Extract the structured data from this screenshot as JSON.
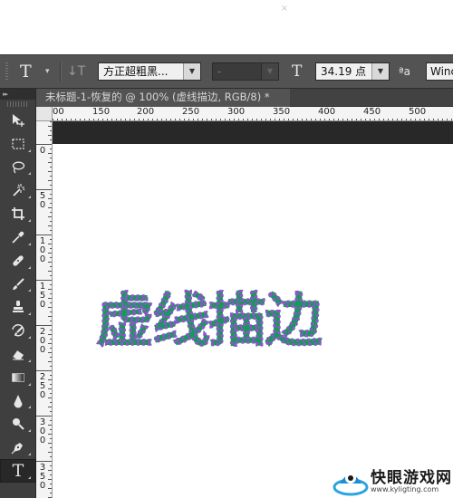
{
  "options_bar": {
    "tool_glyph": "T",
    "orientation_glyph": "↓T",
    "font_family": "方正超粗黑...",
    "font_style": "-",
    "size_glyph": "T",
    "font_size": "34.19 点",
    "antialias_glyph": "ªa",
    "antialias_value": "Winc"
  },
  "toolbar": {
    "collapse_glyph": "▸▸",
    "tools": [
      {
        "name": "move",
        "active": false
      },
      {
        "name": "marquee",
        "active": false
      },
      {
        "name": "lasso",
        "active": false
      },
      {
        "name": "magic-wand",
        "active": false
      },
      {
        "name": "crop",
        "active": false
      },
      {
        "name": "eyedropper",
        "active": false
      },
      {
        "name": "healing-brush",
        "active": false
      },
      {
        "name": "brush",
        "active": false
      },
      {
        "name": "clone-stamp",
        "active": false
      },
      {
        "name": "history-brush",
        "active": false
      },
      {
        "name": "eraser",
        "active": false
      },
      {
        "name": "gradient",
        "active": false
      },
      {
        "name": "blur",
        "active": false
      },
      {
        "name": "dodge",
        "active": false
      },
      {
        "name": "pen",
        "active": false
      },
      {
        "name": "type",
        "active": true
      }
    ],
    "type_glyph": "T"
  },
  "document": {
    "tab_title": "未标题-1-恢复的 @ 100% (虚线描边, RGB/8) *",
    "close_glyph": "×",
    "canvas_text": "虚线描边",
    "text_fill": "#159a57",
    "stroke_color": "#8a56c8"
  },
  "rulers": {
    "top_labels": [
      "100",
      "150",
      "200",
      "250",
      "300",
      "350",
      "400",
      "450",
      "500"
    ],
    "left_labels": [
      "0",
      "5 0",
      "1 0 0",
      "1 5 0",
      "2 0 0",
      "2 5 0",
      "3 0 0",
      "3 5 0"
    ]
  },
  "watermark": {
    "title": "快眼游戏网",
    "url": "www.kyligting.com"
  }
}
